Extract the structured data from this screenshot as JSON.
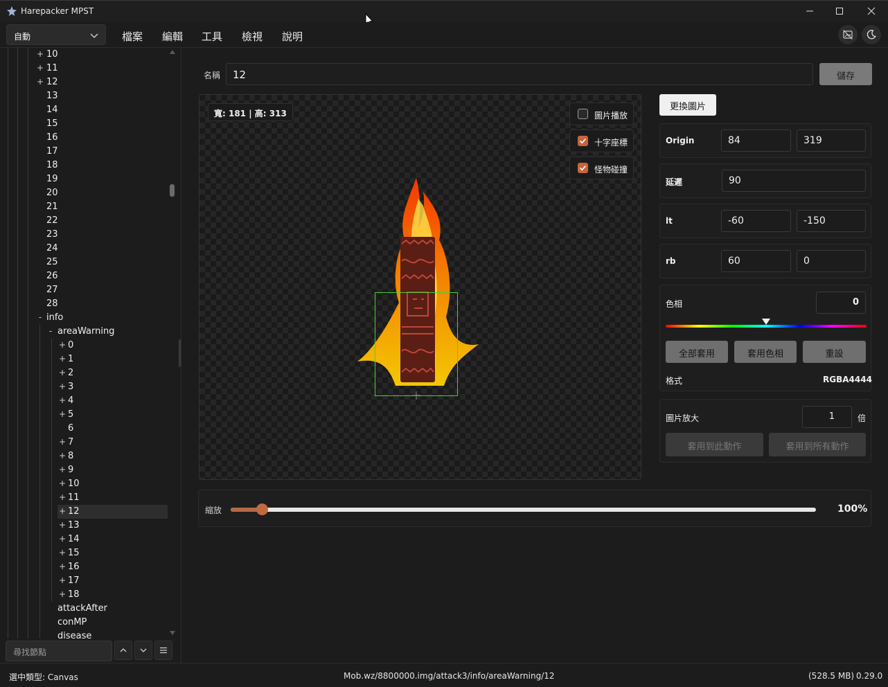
{
  "window": {
    "title": "Harepacker MPST"
  },
  "menubar": {
    "mode_value": "自動",
    "items": [
      "檔案",
      "編輯",
      "工具",
      "檢視",
      "說明"
    ]
  },
  "tree": {
    "items": [
      {
        "label": "10",
        "expander": "+"
      },
      {
        "label": "11",
        "expander": "+"
      },
      {
        "label": "12",
        "expander": "+"
      },
      {
        "label": "13",
        "expander": ""
      },
      {
        "label": "14",
        "expander": ""
      },
      {
        "label": "15",
        "expander": ""
      },
      {
        "label": "16",
        "expander": ""
      },
      {
        "label": "17",
        "expander": ""
      },
      {
        "label": "18",
        "expander": ""
      },
      {
        "label": "19",
        "expander": ""
      },
      {
        "label": "20",
        "expander": ""
      },
      {
        "label": "21",
        "expander": ""
      },
      {
        "label": "22",
        "expander": ""
      },
      {
        "label": "23",
        "expander": ""
      },
      {
        "label": "24",
        "expander": ""
      },
      {
        "label": "25",
        "expander": ""
      },
      {
        "label": "26",
        "expander": ""
      },
      {
        "label": "27",
        "expander": ""
      },
      {
        "label": "28",
        "expander": ""
      },
      {
        "label": "info",
        "expander": "-"
      },
      {
        "label": "areaWarning",
        "expander": "-"
      },
      {
        "label": "0",
        "expander": "+"
      },
      {
        "label": "1",
        "expander": "+"
      },
      {
        "label": "2",
        "expander": "+"
      },
      {
        "label": "3",
        "expander": "+"
      },
      {
        "label": "4",
        "expander": "+"
      },
      {
        "label": "5",
        "expander": "+"
      },
      {
        "label": "6",
        "expander": ""
      },
      {
        "label": "7",
        "expander": "+"
      },
      {
        "label": "8",
        "expander": "+"
      },
      {
        "label": "9",
        "expander": "+"
      },
      {
        "label": "10",
        "expander": "+"
      },
      {
        "label": "11",
        "expander": "+"
      },
      {
        "label": "12",
        "expander": "+",
        "selected": true
      },
      {
        "label": "13",
        "expander": "+"
      },
      {
        "label": "14",
        "expander": "+"
      },
      {
        "label": "15",
        "expander": "+"
      },
      {
        "label": "16",
        "expander": "+"
      },
      {
        "label": "17",
        "expander": "+"
      },
      {
        "label": "18",
        "expander": "+"
      },
      {
        "label": "attackAfter",
        "expander": ""
      },
      {
        "label": "conMP",
        "expander": ""
      },
      {
        "label": "disease",
        "expander": ""
      }
    ],
    "search_placeholder": "尋找節點"
  },
  "editor": {
    "name_label": "名稱",
    "name_value": "12",
    "save_label": "儲存",
    "dims_text": "寬: 181 | 高: 313",
    "checkboxes": [
      {
        "label": "圖片播放",
        "checked": false
      },
      {
        "label": "十字座標",
        "checked": true
      },
      {
        "label": "怪物碰撞",
        "checked": true
      }
    ],
    "change_image_label": "更換圖片",
    "origin": {
      "label": "Origin",
      "x": "84",
      "y": "319"
    },
    "delay": {
      "label": "延遲",
      "value": "90"
    },
    "lt": {
      "label": "lt",
      "x": "-60",
      "y": "-150"
    },
    "rb": {
      "label": "rb",
      "x": "60",
      "y": "0"
    },
    "hue": {
      "label": "色相",
      "value": "0",
      "apply_all": "全部套用",
      "apply_hue": "套用色相",
      "reset": "重設"
    },
    "format": {
      "label": "格式",
      "value": "RGBA4444"
    },
    "scale": {
      "label": "圖片放大",
      "value": "1",
      "unit": "倍",
      "apply_this": "套用到此動作",
      "apply_all": "套用到所有動作"
    },
    "zoom": {
      "label": "縮放",
      "value_text": "100%",
      "fraction": 0.053
    }
  },
  "status": {
    "type_text": "選中類型: Canvas",
    "path_text": "Mob.wz/8800000.img/attack3/info/areaWarning/12",
    "mem_text": "(528.5 MB)",
    "version_text": "0.29.0"
  },
  "colors": {
    "accent": "#c8643a",
    "selection_box": "#4ccf3a"
  }
}
